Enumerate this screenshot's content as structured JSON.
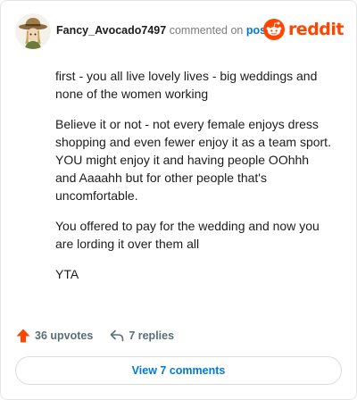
{
  "header": {
    "username": "Fancy_Avocado7497",
    "action_text": "commented on",
    "post_link": "post",
    "brand": "reddit"
  },
  "comment": {
    "paragraphs": [
      "first - you all live lovely lives - big weddings and none of the women working",
      "Believe it or not - not every female enjoys dress shopping and even fewer enjoy it as a team sport. YOU might enjoy it and having people OOhhh and Aaaahh but for other people that's uncomfortable.",
      "You offered to pay for the wedding and now you are lording it over them all",
      "YTA"
    ]
  },
  "actions": {
    "upvotes_label": "36 upvotes",
    "replies_label": "7 replies"
  },
  "footer": {
    "view_comments_label": "View 7 comments"
  },
  "colors": {
    "brand": "#ff4500",
    "link": "#0079d3",
    "meta": "#7c7c7c"
  },
  "icons": {
    "avatar": "cowboy-avocado-avatar",
    "logo": "reddit-alien-icon",
    "upvote": "upvote-arrow-icon",
    "reply": "reply-arrow-icon"
  }
}
